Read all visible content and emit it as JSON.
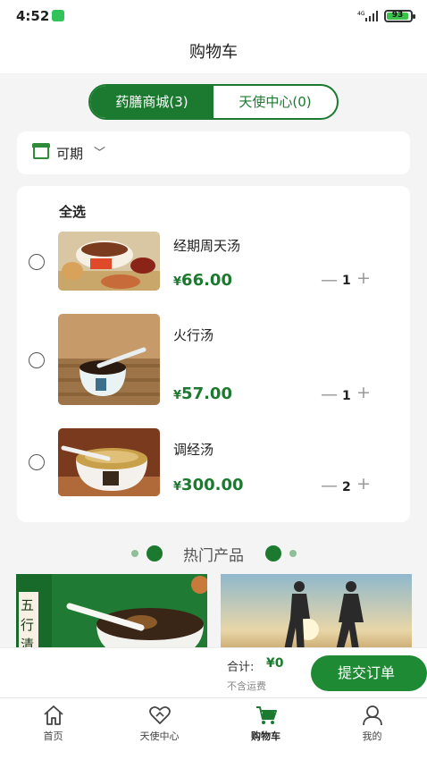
{
  "status": {
    "time": "4:52",
    "network": "4G",
    "battery": "93",
    "battery_level": 0.93
  },
  "page_title": "购物车",
  "segment": {
    "active_label": "药膳商城(3)",
    "inactive_label": "天使中心(0)"
  },
  "filter": {
    "label": "可期",
    "icon": "shop-icon"
  },
  "cart": {
    "select_all": "全选",
    "items": [
      {
        "name": "经期周天汤",
        "yen": "¥",
        "price": "66.00",
        "minus": "—",
        "qty": "1",
        "plus": "+"
      },
      {
        "name": "火行汤",
        "yen": "¥",
        "price": "57.00",
        "minus": "—",
        "qty": "1",
        "plus": "+"
      },
      {
        "name": "调经汤",
        "yen": "¥",
        "price": "300.00",
        "minus": "—",
        "qty": "2",
        "plus": "+"
      }
    ]
  },
  "hot": {
    "title": "热门产品",
    "banner_chars": [
      "五",
      "行",
      "清"
    ]
  },
  "checkout": {
    "total_label": "合计:",
    "total_value": "¥0",
    "shipping_note": "不含运费",
    "submit_label": "提交订单"
  },
  "tabs": [
    {
      "label": "首页",
      "icon": "home-icon"
    },
    {
      "label": "天使中心",
      "icon": "heart-icon"
    },
    {
      "label": "购物车",
      "icon": "cart-icon",
      "active": true
    },
    {
      "label": "我的",
      "icon": "user-icon"
    }
  ],
  "colors": {
    "brand_green": "#1b7a2f",
    "bg": "#f4f4f4"
  }
}
